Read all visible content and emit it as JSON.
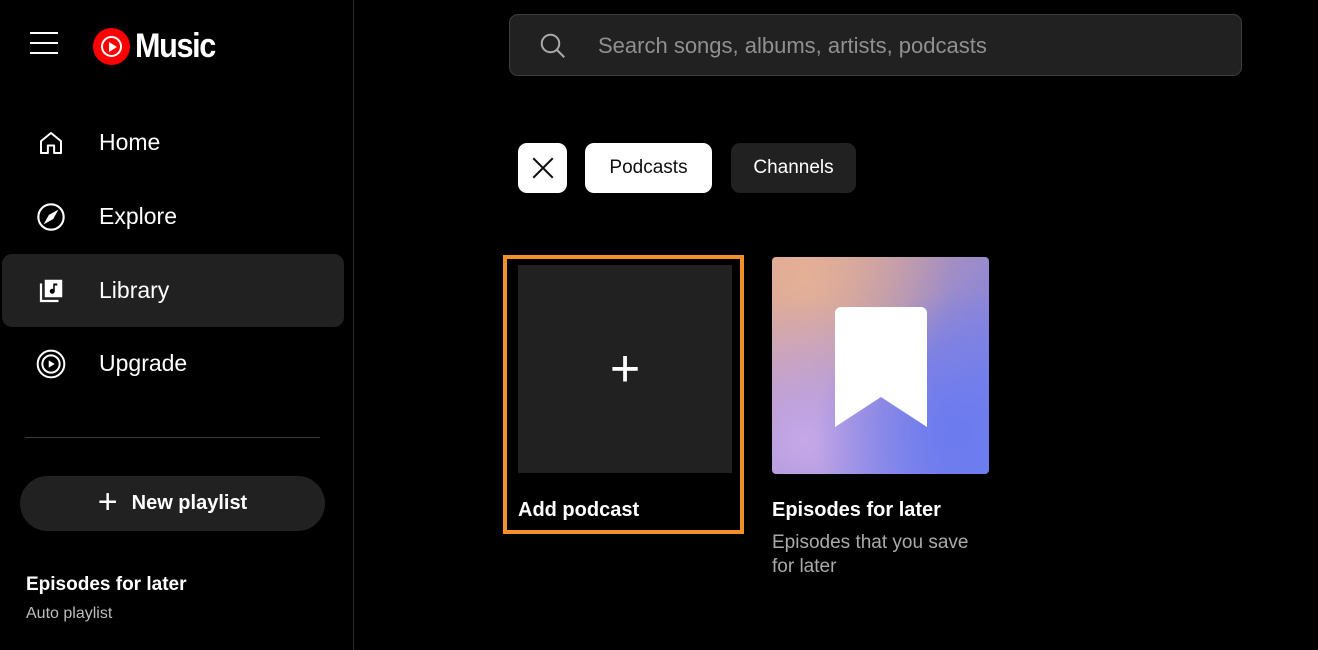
{
  "header": {
    "logo_text": "Music",
    "search_placeholder": "Search songs, albums, artists, podcasts"
  },
  "sidebar": {
    "items": [
      {
        "label": "Home",
        "icon": "home-icon",
        "active": false
      },
      {
        "label": "Explore",
        "icon": "compass-icon",
        "active": false
      },
      {
        "label": "Library",
        "icon": "library-icon",
        "active": true
      },
      {
        "label": "Upgrade",
        "icon": "upgrade-icon",
        "active": false
      }
    ],
    "new_playlist_label": "New playlist",
    "playlists": [
      {
        "title": "Episodes for later",
        "subtitle": "Auto playlist"
      }
    ]
  },
  "filters": {
    "chips": [
      {
        "label": "Podcasts",
        "selected": true
      },
      {
        "label": "Channels",
        "selected": false
      }
    ]
  },
  "grid": {
    "add_card_label": "Add podcast",
    "items": [
      {
        "title": "Episodes for later",
        "description": "Episodes that you save for later"
      }
    ]
  },
  "colors": {
    "accent_highlight": "#f4902a",
    "brand_red": "#ff0000",
    "chip_selected_bg": "#ffffff",
    "surface": "#212121"
  }
}
